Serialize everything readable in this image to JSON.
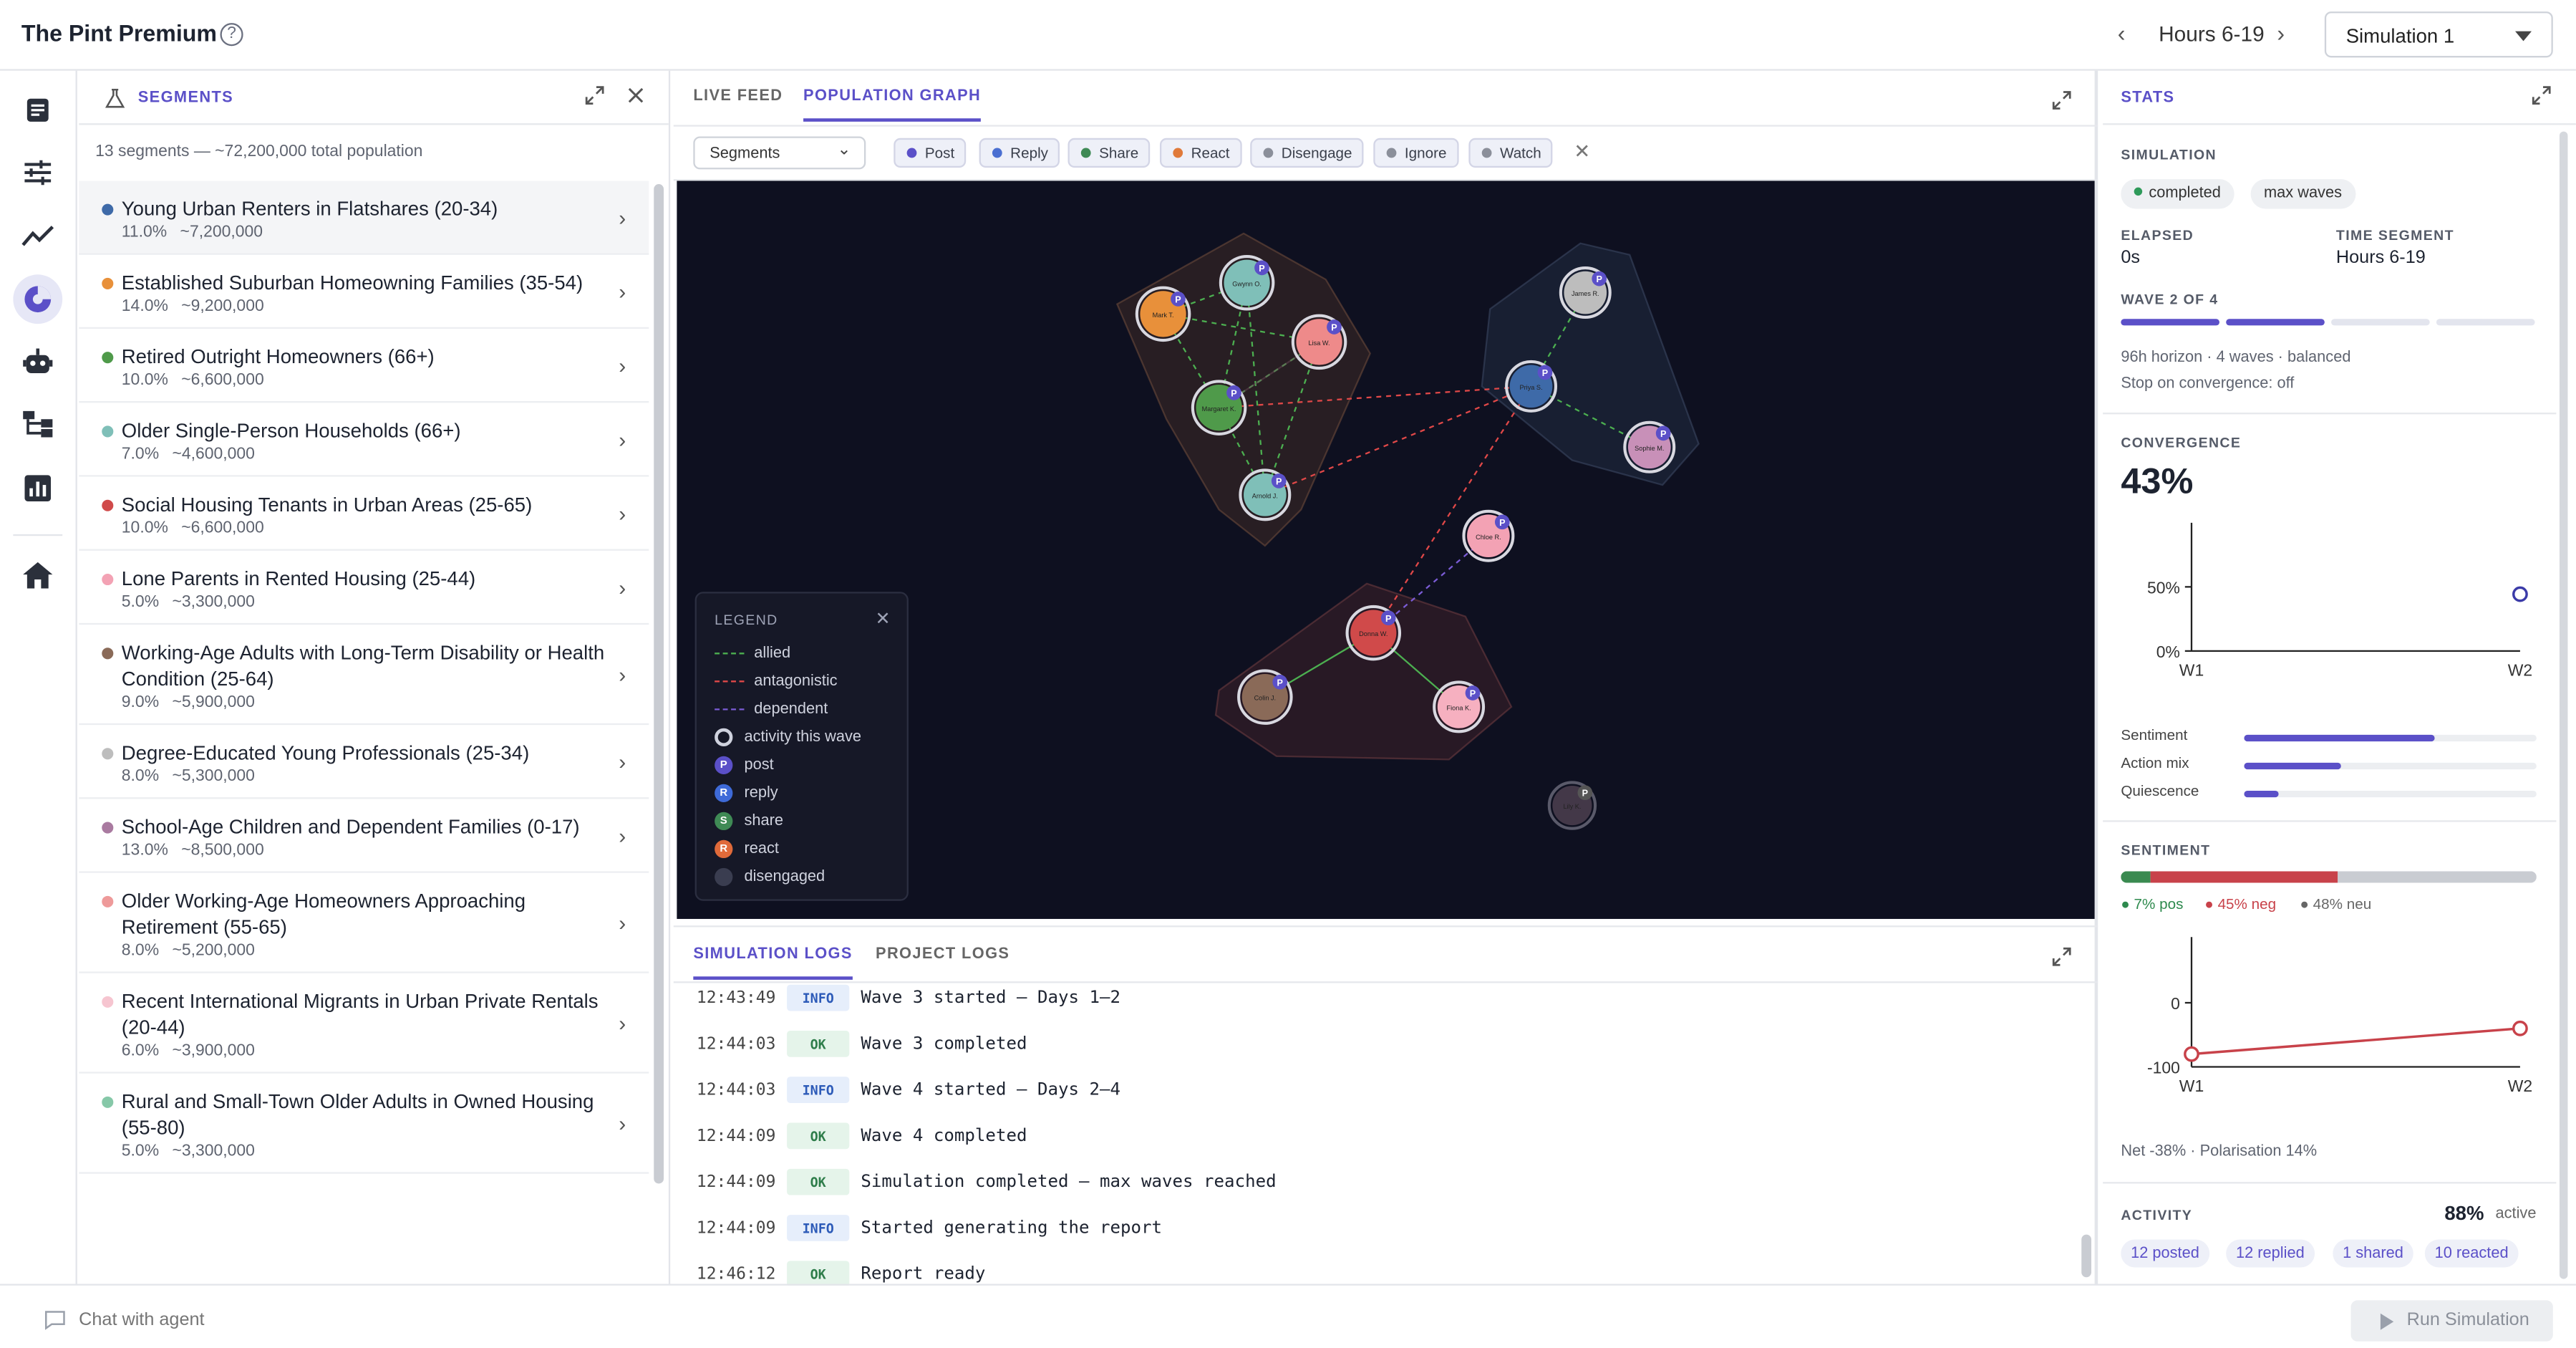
{
  "header": {
    "title": "The Pint Premium",
    "help_icon": "?",
    "hours_label": "Hours 6-19",
    "prev_glyph": "‹",
    "next_glyph": "›",
    "simulation_select": "Simulation 1"
  },
  "nav": {
    "items": [
      "document-icon",
      "sliders-icon",
      "trend-icon",
      "pie-chart-icon",
      "robot-icon",
      "hierarchy-icon",
      "bar-chart-icon",
      "home-icon"
    ],
    "active": "pie-chart-icon"
  },
  "segments": {
    "title": "SEGMENTS",
    "summary": "13 segments — ~72,200,000 total population",
    "items": [
      {
        "name": "Young Urban Renters in Flatshares (20-34)",
        "pct": "11.0%",
        "pop": "~7,200,000",
        "color": "#3e6aa8"
      },
      {
        "name": "Established Suburban Homeowning Families (35-54)",
        "pct": "14.0%",
        "pop": "~9,200,000",
        "color": "#e8903a"
      },
      {
        "name": "Retired Outright Homeowners (66+)",
        "pct": "10.0%",
        "pop": "~6,600,000",
        "color": "#4f9a4a"
      },
      {
        "name": "Older Single-Person Households (66+)",
        "pct": "7.0%",
        "pop": "~4,600,000",
        "color": "#7fbfb8"
      },
      {
        "name": "Social Housing Tenants in Urban Areas (25-65)",
        "pct": "10.0%",
        "pop": "~6,600,000",
        "color": "#d04a4a"
      },
      {
        "name": "Lone Parents in Rented Housing (25-44)",
        "pct": "5.0%",
        "pop": "~3,300,000",
        "color": "#f3a2b4"
      },
      {
        "name": "Working-Age Adults with Long-Term Disability or Health Condition (25-64)",
        "pct": "9.0%",
        "pop": "~5,900,000",
        "color": "#8a6a58"
      },
      {
        "name": "Degree-Educated Young Professionals (25-34)",
        "pct": "8.0%",
        "pop": "~5,300,000",
        "color": "#bdbdbd"
      },
      {
        "name": "School-Age Children and Dependent Families (0-17)",
        "pct": "13.0%",
        "pop": "~8,500,000",
        "color": "#a97aa0"
      },
      {
        "name": "Older Working-Age Homeowners Approaching Retirement (55-65)",
        "pct": "8.0%",
        "pop": "~5,200,000",
        "color": "#ee9a9a"
      },
      {
        "name": "Recent International Migrants in Urban Private Rentals (20-44)",
        "pct": "6.0%",
        "pop": "~3,900,000",
        "color": "#f6c5d0"
      },
      {
        "name": "Rural and Small-Town Older Adults in Owned Housing (55-80)",
        "pct": "5.0%",
        "pop": "~3,300,000",
        "color": "#86c8a8"
      }
    ]
  },
  "center": {
    "tabs": [
      "LIVE FEED",
      "POPULATION GRAPH"
    ],
    "active_tab": "POPULATION GRAPH",
    "filter_select": "Segments",
    "chips": [
      {
        "label": "Post",
        "color": "#5b50c8"
      },
      {
        "label": "Reply",
        "color": "#4a6fd1"
      },
      {
        "label": "Share",
        "color": "#3f8a55"
      },
      {
        "label": "React",
        "color": "#e07a3a"
      },
      {
        "label": "Disengage",
        "color": "#8b8f9a"
      },
      {
        "label": "Ignore",
        "color": "#8b8f9a"
      },
      {
        "label": "Watch",
        "color": "#8b8f9a"
      }
    ],
    "chip_close": "✕",
    "legend": {
      "title": "LEGEND",
      "close": "✕",
      "lines": [
        {
          "label": "allied",
          "color": "#4caf50"
        },
        {
          "label": "antagonistic",
          "color": "#e04848"
        },
        {
          "label": "dependent",
          "color": "#7b5cd6"
        }
      ],
      "badges": [
        {
          "label": "activity this wave",
          "letter": "",
          "color": "#cfd2de"
        },
        {
          "label": "post",
          "letter": "P",
          "color": "#5b50c8"
        },
        {
          "label": "reply",
          "letter": "R",
          "color": "#3e6ad8"
        },
        {
          "label": "share",
          "letter": "S",
          "color": "#3f8a55"
        },
        {
          "label": "react",
          "letter": "R",
          "color": "#e06a3a"
        },
        {
          "label": "disengaged",
          "letter": "",
          "color": "#3a3d50"
        }
      ]
    },
    "nodes": [
      {
        "id": "n1",
        "label": "Mark T.",
        "color": "#e8903a",
        "badge": "P"
      },
      {
        "id": "n2",
        "label": "Gwynn O.",
        "color": "#7fbfb8",
        "badge": "P"
      },
      {
        "id": "n3",
        "label": "Lisa W.",
        "color": "#ee8a8a",
        "badge": "P"
      },
      {
        "id": "n4",
        "label": "Margaret K.",
        "color": "#4f9a4a",
        "badge": "P"
      },
      {
        "id": "n5",
        "label": "Arnold J.",
        "color": "#7fbfb8",
        "badge": "P"
      },
      {
        "id": "n6",
        "label": "James R.",
        "color": "#bdbdbd",
        "badge": "P"
      },
      {
        "id": "n7",
        "label": "Priya S.",
        "color": "#3e6aa8",
        "badge": "P"
      },
      {
        "id": "n8",
        "label": "Sophie M.",
        "color": "#c890b8",
        "badge": "P"
      },
      {
        "id": "n9",
        "label": "Chloe R.",
        "color": "#f3a2b4",
        "badge": "P"
      },
      {
        "id": "n10",
        "label": "Donna W.",
        "color": "#d04a4a",
        "badge": "P"
      },
      {
        "id": "n11",
        "label": "Colin J.",
        "color": "#8a6a58",
        "badge": "P"
      },
      {
        "id": "n12",
        "label": "Fiona K.",
        "color": "#f6b0c0",
        "badge": "P"
      },
      {
        "id": "n13",
        "label": "Lily K.",
        "color": "#5a4a5a",
        "badge": "P"
      }
    ],
    "logs_tabs": [
      "SIMULATION LOGS",
      "PROJECT LOGS"
    ],
    "logs_active": "SIMULATION LOGS",
    "logs": [
      {
        "time": "12:43:49",
        "level": "INFO",
        "msg": "Wave 3 started — Days 1–2"
      },
      {
        "time": "12:44:03",
        "level": "OK",
        "msg": "Wave 3 completed"
      },
      {
        "time": "12:44:03",
        "level": "INFO",
        "msg": "Wave 4 started — Days 2–4"
      },
      {
        "time": "12:44:09",
        "level": "OK",
        "msg": "Wave 4 completed"
      },
      {
        "time": "12:44:09",
        "level": "OK",
        "msg": "Simulation completed — max waves reached"
      },
      {
        "time": "12:44:09",
        "level": "INFO",
        "msg": "Started generating the report"
      },
      {
        "time": "12:46:12",
        "level": "OK",
        "msg": "Report ready"
      }
    ]
  },
  "stats": {
    "title": "STATS",
    "simulation": {
      "label": "SIMULATION",
      "status": "completed",
      "mode": "max waves",
      "elapsed_label": "ELAPSED",
      "elapsed": "0s",
      "segment_label": "TIME SEGMENT",
      "segment": "Hours 6-19",
      "wave_label": "WAVE 2 OF 4",
      "wave_current": 2,
      "wave_total": 4,
      "horizon": "96h horizon · 4 waves · balanced",
      "convergence_note": "Stop on convergence: off"
    },
    "convergence": {
      "label": "CONVERGENCE",
      "value": "43%",
      "y_ticks": [
        "50%",
        "0%"
      ],
      "x_ticks": [
        "W1",
        "W2"
      ],
      "bars": [
        {
          "label": "Sentiment",
          "value": 0.65
        },
        {
          "label": "Action mix",
          "value": 0.33
        },
        {
          "label": "Quiescence",
          "value": 0.12
        }
      ]
    },
    "sentiment": {
      "label": "SENTIMENT",
      "pos_label": "● 7% pos",
      "neg_label": "● 45% neg",
      "neu_label": "● 48% neu",
      "pos": 7,
      "neg": 45,
      "neu": 48,
      "y_ticks": [
        "0",
        "-100"
      ],
      "x_ticks": [
        "W1",
        "W2"
      ],
      "footer": "Net -38% · Polarisation 14%"
    },
    "activity": {
      "label": "ACTIVITY",
      "value": "88%",
      "suffix": "active",
      "chips": [
        "12 posted",
        "12 replied",
        "1 shared",
        "10 reacted"
      ]
    }
  },
  "bottom": {
    "chat_placeholder": "Chat with agent",
    "run_label": "Run Simulation"
  },
  "chart_data": [
    {
      "type": "scatter",
      "title": "",
      "x": [
        "W1",
        "W2"
      ],
      "series": [
        {
          "values": [
            null,
            43
          ]
        }
      ],
      "ylim": [
        0,
        100
      ],
      "y_ticks": [
        "0%",
        "50%"
      ]
    },
    {
      "type": "line",
      "title": "",
      "x": [
        "W1",
        "W2"
      ],
      "series": [
        {
          "values": [
            -80,
            -40
          ]
        }
      ],
      "ylim": [
        -100,
        0
      ],
      "y_ticks": [
        "-100",
        "0"
      ]
    }
  ]
}
